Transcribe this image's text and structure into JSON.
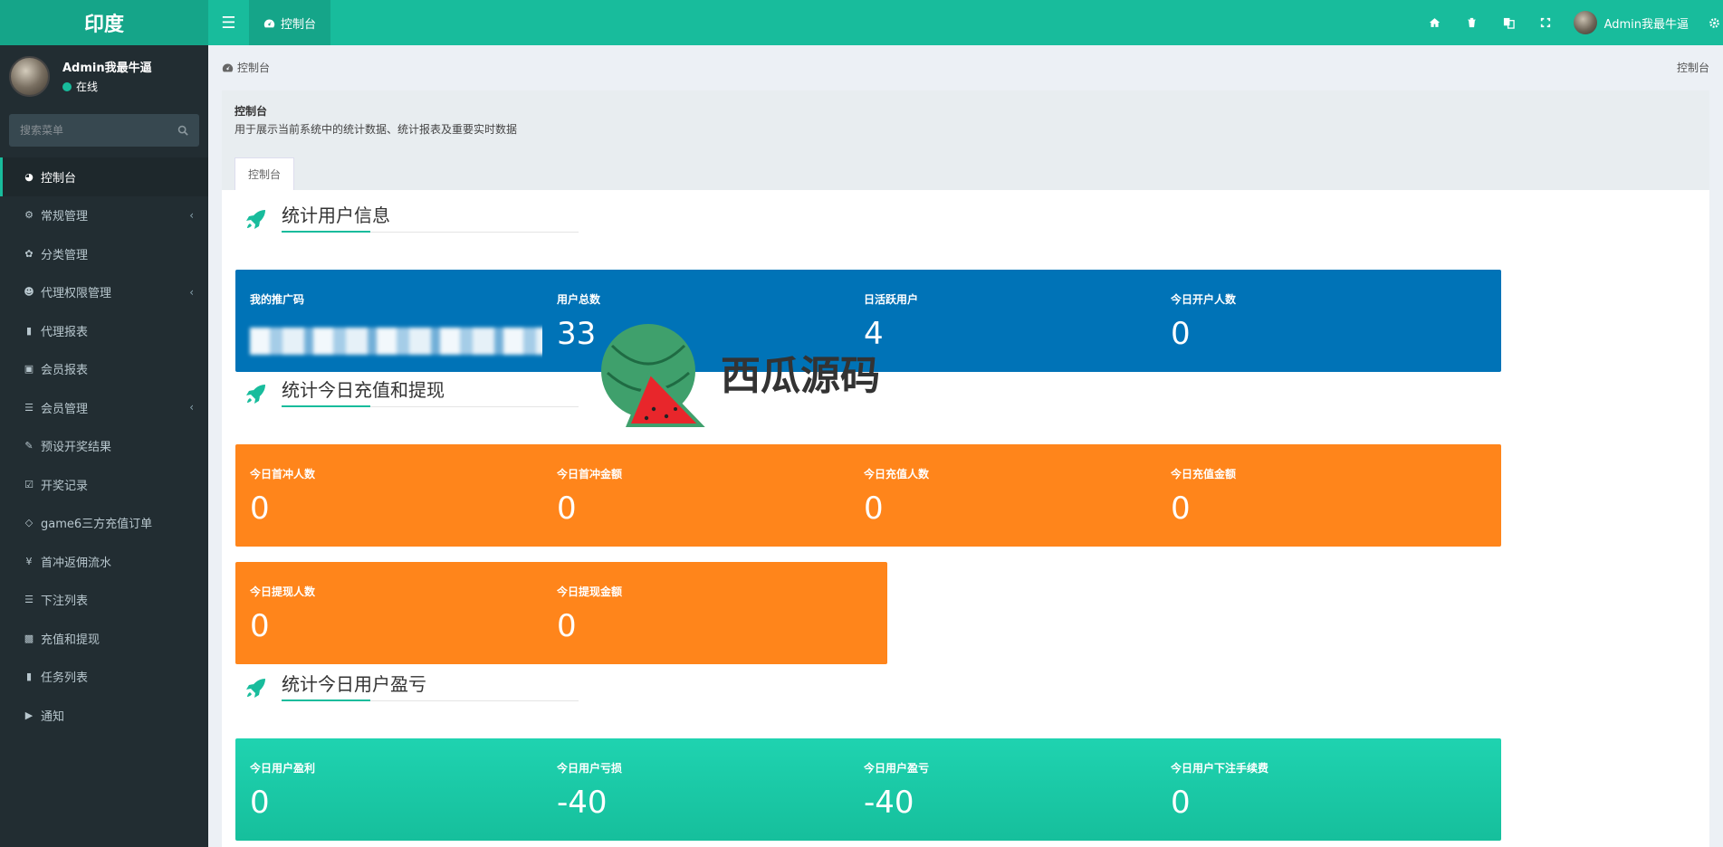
{
  "app": {
    "brand": "印度"
  },
  "topbar": {
    "active_tab": "控制台",
    "user_name": "Admin我最牛逼"
  },
  "sidebar": {
    "user_name": "Admin我最牛逼",
    "status": "在线",
    "search_placeholder": "搜索菜单",
    "items": [
      {
        "label": "控制台",
        "icon": "dashboard-icon",
        "active": true,
        "expandable": false
      },
      {
        "label": "常规管理",
        "icon": "cogs-icon",
        "active": false,
        "expandable": true
      },
      {
        "label": "分类管理",
        "icon": "leaf-icon",
        "active": false,
        "expandable": false
      },
      {
        "label": "代理权限管理",
        "icon": "group-icon",
        "active": false,
        "expandable": true
      },
      {
        "label": "代理报表",
        "icon": "book-icon",
        "active": false,
        "expandable": false
      },
      {
        "label": "会员报表",
        "icon": "address-book-icon",
        "active": false,
        "expandable": false
      },
      {
        "label": "会员管理",
        "icon": "list-icon",
        "active": false,
        "expandable": true
      },
      {
        "label": "预设开奖结果",
        "icon": "edit-icon",
        "active": false,
        "expandable": false
      },
      {
        "label": "开奖记录",
        "icon": "calendar-check-icon",
        "active": false,
        "expandable": false
      },
      {
        "label": "game6三方充值订单",
        "icon": "diamond-icon",
        "active": false,
        "expandable": false
      },
      {
        "label": "首冲返佣流水",
        "icon": "yen-icon",
        "active": false,
        "expandable": false
      },
      {
        "label": "下注列表",
        "icon": "list-icon",
        "active": false,
        "expandable": false
      },
      {
        "label": "充值和提现",
        "icon": "money-icon",
        "active": false,
        "expandable": false
      },
      {
        "label": "任务列表",
        "icon": "book-icon",
        "active": false,
        "expandable": false
      },
      {
        "label": "通知",
        "icon": "bullhorn-icon",
        "active": false,
        "expandable": false
      }
    ]
  },
  "breadcrumb": {
    "left": "控制台",
    "right": "控制台"
  },
  "panel": {
    "title": "控制台",
    "description": "用于展示当前系统中的统计数据、统计报表及重要实时数据",
    "tab": "控制台"
  },
  "sections": [
    {
      "title": "统计用户信息",
      "cards": [
        {
          "label": "我的推广码",
          "value": "",
          "color": "blue"
        },
        {
          "label": "用户总数",
          "value": "33",
          "color": "blue"
        },
        {
          "label": "日活跃用户",
          "value": "4",
          "color": "blue"
        },
        {
          "label": "今日开户人数",
          "value": "0",
          "color": "blue"
        }
      ]
    },
    {
      "title": "统计今日充值和提现",
      "cards": [
        {
          "label": "今日首冲人数",
          "value": "0",
          "color": "orange"
        },
        {
          "label": "今日首冲金额",
          "value": "0",
          "color": "orange"
        },
        {
          "label": "今日充值人数",
          "value": "0",
          "color": "orange"
        },
        {
          "label": "今日充值金额",
          "value": "0",
          "color": "orange"
        },
        {
          "label": "今日提现人数",
          "value": "0",
          "color": "orange"
        },
        {
          "label": "今日提现金额",
          "value": "0",
          "color": "orange"
        }
      ]
    },
    {
      "title": "统计今日用户盈亏",
      "cards": [
        {
          "label": "今日用户盈利",
          "value": "0",
          "color": "green"
        },
        {
          "label": "今日用户亏损",
          "value": "-40",
          "color": "green"
        },
        {
          "label": "今日用户盈亏",
          "value": "-40",
          "color": "green"
        },
        {
          "label": "今日用户下注手续费",
          "value": "0",
          "color": "green"
        }
      ]
    }
  ],
  "watermark": {
    "text": "西瓜源码"
  },
  "colors": {
    "accent": "#18bc9c",
    "blue": "#0073b7",
    "orange": "#ff851b",
    "green": "#1bc9a6",
    "sidebar": "#222d32"
  }
}
